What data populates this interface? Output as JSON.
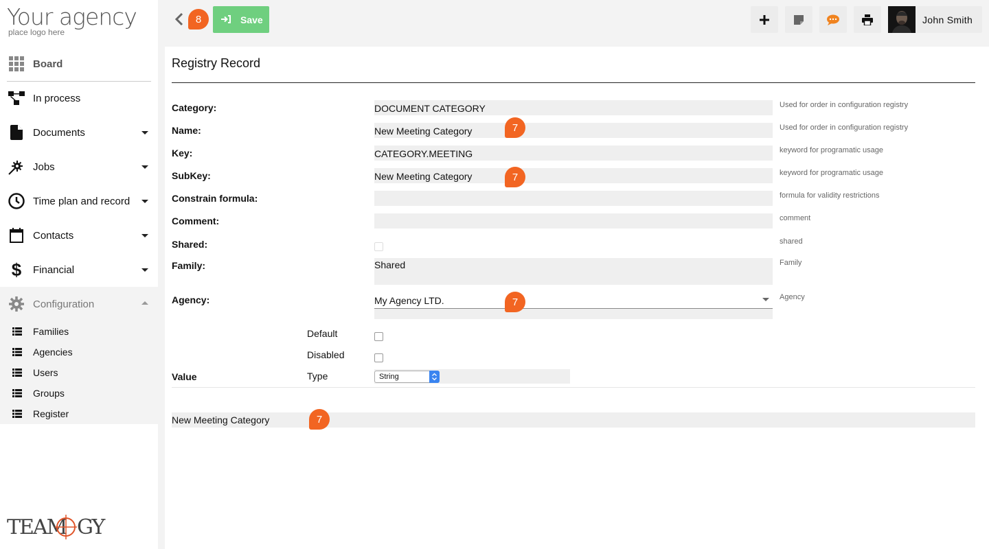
{
  "logo": {
    "title": "Your agency",
    "subtitle": "place logo here",
    "brand": "TEAMOGY"
  },
  "nav": {
    "board": "Board",
    "in_process": "In process",
    "documents": "Documents",
    "jobs": "Jobs",
    "time_plan": "Time plan and record",
    "contacts": "Contacts",
    "financial": "Financial",
    "configuration": "Configuration",
    "sub_items": [
      "Families",
      "Agencies",
      "Users",
      "Groups",
      "Register"
    ]
  },
  "topbar": {
    "back_badge": "8",
    "save_label": "Save",
    "user_name": "John Smith"
  },
  "form": {
    "title": "Registry Record",
    "rows": [
      {
        "label": "Category:",
        "value": "DOCUMENT CATEGORY",
        "hint": "Used for order in configuration registry"
      },
      {
        "label": "Name:",
        "value": "New Meeting Category",
        "hint": "Used for order in configuration registry",
        "badge": "7"
      },
      {
        "label": "Key:",
        "value": "CATEGORY.MEETING",
        "hint": "keyword for programatic usage"
      },
      {
        "label": "SubKey:",
        "value": "New Meeting Category",
        "hint": "keyword for programatic usage",
        "badge": "7"
      },
      {
        "label": "Constrain formula:",
        "value": "",
        "hint": "formula for validity restrictions"
      },
      {
        "label": "Comment:",
        "value": "",
        "hint": "comment"
      }
    ],
    "shared": {
      "label": "Shared:",
      "hint": "shared",
      "checked": false
    },
    "family": {
      "label": "Family:",
      "value": "Shared",
      "hint": "Family"
    },
    "agency": {
      "label": "Agency:",
      "value": "My Agency LTD.",
      "hint": "Agency",
      "badge": "7"
    },
    "default_label": "Default",
    "disabled_label": "Disabled",
    "value_label": "Value",
    "type_label": "Type",
    "type_value": "String",
    "value_text": "New Meeting Category",
    "value_badge": "7"
  },
  "colors": {
    "accent": "#f26522",
    "save": "#6fcf7f"
  }
}
